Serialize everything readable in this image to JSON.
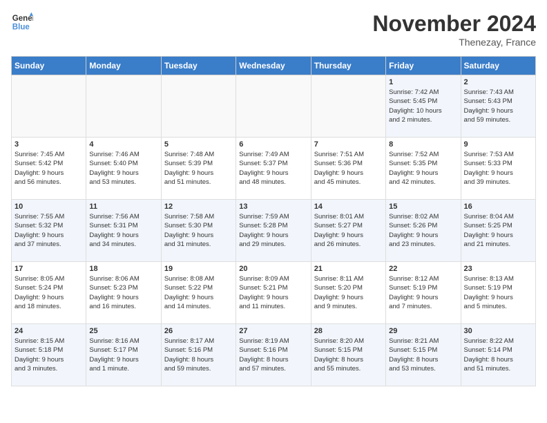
{
  "logo": {
    "line1": "General",
    "line2": "Blue"
  },
  "title": "November 2024",
  "location": "Thenezay, France",
  "headers": [
    "Sunday",
    "Monday",
    "Tuesday",
    "Wednesday",
    "Thursday",
    "Friday",
    "Saturday"
  ],
  "weeks": [
    [
      {
        "day": "",
        "info": ""
      },
      {
        "day": "",
        "info": ""
      },
      {
        "day": "",
        "info": ""
      },
      {
        "day": "",
        "info": ""
      },
      {
        "day": "",
        "info": ""
      },
      {
        "day": "1",
        "info": "Sunrise: 7:42 AM\nSunset: 5:45 PM\nDaylight: 10 hours\nand 2 minutes."
      },
      {
        "day": "2",
        "info": "Sunrise: 7:43 AM\nSunset: 5:43 PM\nDaylight: 9 hours\nand 59 minutes."
      }
    ],
    [
      {
        "day": "3",
        "info": "Sunrise: 7:45 AM\nSunset: 5:42 PM\nDaylight: 9 hours\nand 56 minutes."
      },
      {
        "day": "4",
        "info": "Sunrise: 7:46 AM\nSunset: 5:40 PM\nDaylight: 9 hours\nand 53 minutes."
      },
      {
        "day": "5",
        "info": "Sunrise: 7:48 AM\nSunset: 5:39 PM\nDaylight: 9 hours\nand 51 minutes."
      },
      {
        "day": "6",
        "info": "Sunrise: 7:49 AM\nSunset: 5:37 PM\nDaylight: 9 hours\nand 48 minutes."
      },
      {
        "day": "7",
        "info": "Sunrise: 7:51 AM\nSunset: 5:36 PM\nDaylight: 9 hours\nand 45 minutes."
      },
      {
        "day": "8",
        "info": "Sunrise: 7:52 AM\nSunset: 5:35 PM\nDaylight: 9 hours\nand 42 minutes."
      },
      {
        "day": "9",
        "info": "Sunrise: 7:53 AM\nSunset: 5:33 PM\nDaylight: 9 hours\nand 39 minutes."
      }
    ],
    [
      {
        "day": "10",
        "info": "Sunrise: 7:55 AM\nSunset: 5:32 PM\nDaylight: 9 hours\nand 37 minutes."
      },
      {
        "day": "11",
        "info": "Sunrise: 7:56 AM\nSunset: 5:31 PM\nDaylight: 9 hours\nand 34 minutes."
      },
      {
        "day": "12",
        "info": "Sunrise: 7:58 AM\nSunset: 5:30 PM\nDaylight: 9 hours\nand 31 minutes."
      },
      {
        "day": "13",
        "info": "Sunrise: 7:59 AM\nSunset: 5:28 PM\nDaylight: 9 hours\nand 29 minutes."
      },
      {
        "day": "14",
        "info": "Sunrise: 8:01 AM\nSunset: 5:27 PM\nDaylight: 9 hours\nand 26 minutes."
      },
      {
        "day": "15",
        "info": "Sunrise: 8:02 AM\nSunset: 5:26 PM\nDaylight: 9 hours\nand 23 minutes."
      },
      {
        "day": "16",
        "info": "Sunrise: 8:04 AM\nSunset: 5:25 PM\nDaylight: 9 hours\nand 21 minutes."
      }
    ],
    [
      {
        "day": "17",
        "info": "Sunrise: 8:05 AM\nSunset: 5:24 PM\nDaylight: 9 hours\nand 18 minutes."
      },
      {
        "day": "18",
        "info": "Sunrise: 8:06 AM\nSunset: 5:23 PM\nDaylight: 9 hours\nand 16 minutes."
      },
      {
        "day": "19",
        "info": "Sunrise: 8:08 AM\nSunset: 5:22 PM\nDaylight: 9 hours\nand 14 minutes."
      },
      {
        "day": "20",
        "info": "Sunrise: 8:09 AM\nSunset: 5:21 PM\nDaylight: 9 hours\nand 11 minutes."
      },
      {
        "day": "21",
        "info": "Sunrise: 8:11 AM\nSunset: 5:20 PM\nDaylight: 9 hours\nand 9 minutes."
      },
      {
        "day": "22",
        "info": "Sunrise: 8:12 AM\nSunset: 5:19 PM\nDaylight: 9 hours\nand 7 minutes."
      },
      {
        "day": "23",
        "info": "Sunrise: 8:13 AM\nSunset: 5:19 PM\nDaylight: 9 hours\nand 5 minutes."
      }
    ],
    [
      {
        "day": "24",
        "info": "Sunrise: 8:15 AM\nSunset: 5:18 PM\nDaylight: 9 hours\nand 3 minutes."
      },
      {
        "day": "25",
        "info": "Sunrise: 8:16 AM\nSunset: 5:17 PM\nDaylight: 9 hours\nand 1 minute."
      },
      {
        "day": "26",
        "info": "Sunrise: 8:17 AM\nSunset: 5:16 PM\nDaylight: 8 hours\nand 59 minutes."
      },
      {
        "day": "27",
        "info": "Sunrise: 8:19 AM\nSunset: 5:16 PM\nDaylight: 8 hours\nand 57 minutes."
      },
      {
        "day": "28",
        "info": "Sunrise: 8:20 AM\nSunset: 5:15 PM\nDaylight: 8 hours\nand 55 minutes."
      },
      {
        "day": "29",
        "info": "Sunrise: 8:21 AM\nSunset: 5:15 PM\nDaylight: 8 hours\nand 53 minutes."
      },
      {
        "day": "30",
        "info": "Sunrise: 8:22 AM\nSunset: 5:14 PM\nDaylight: 8 hours\nand 51 minutes."
      }
    ]
  ]
}
